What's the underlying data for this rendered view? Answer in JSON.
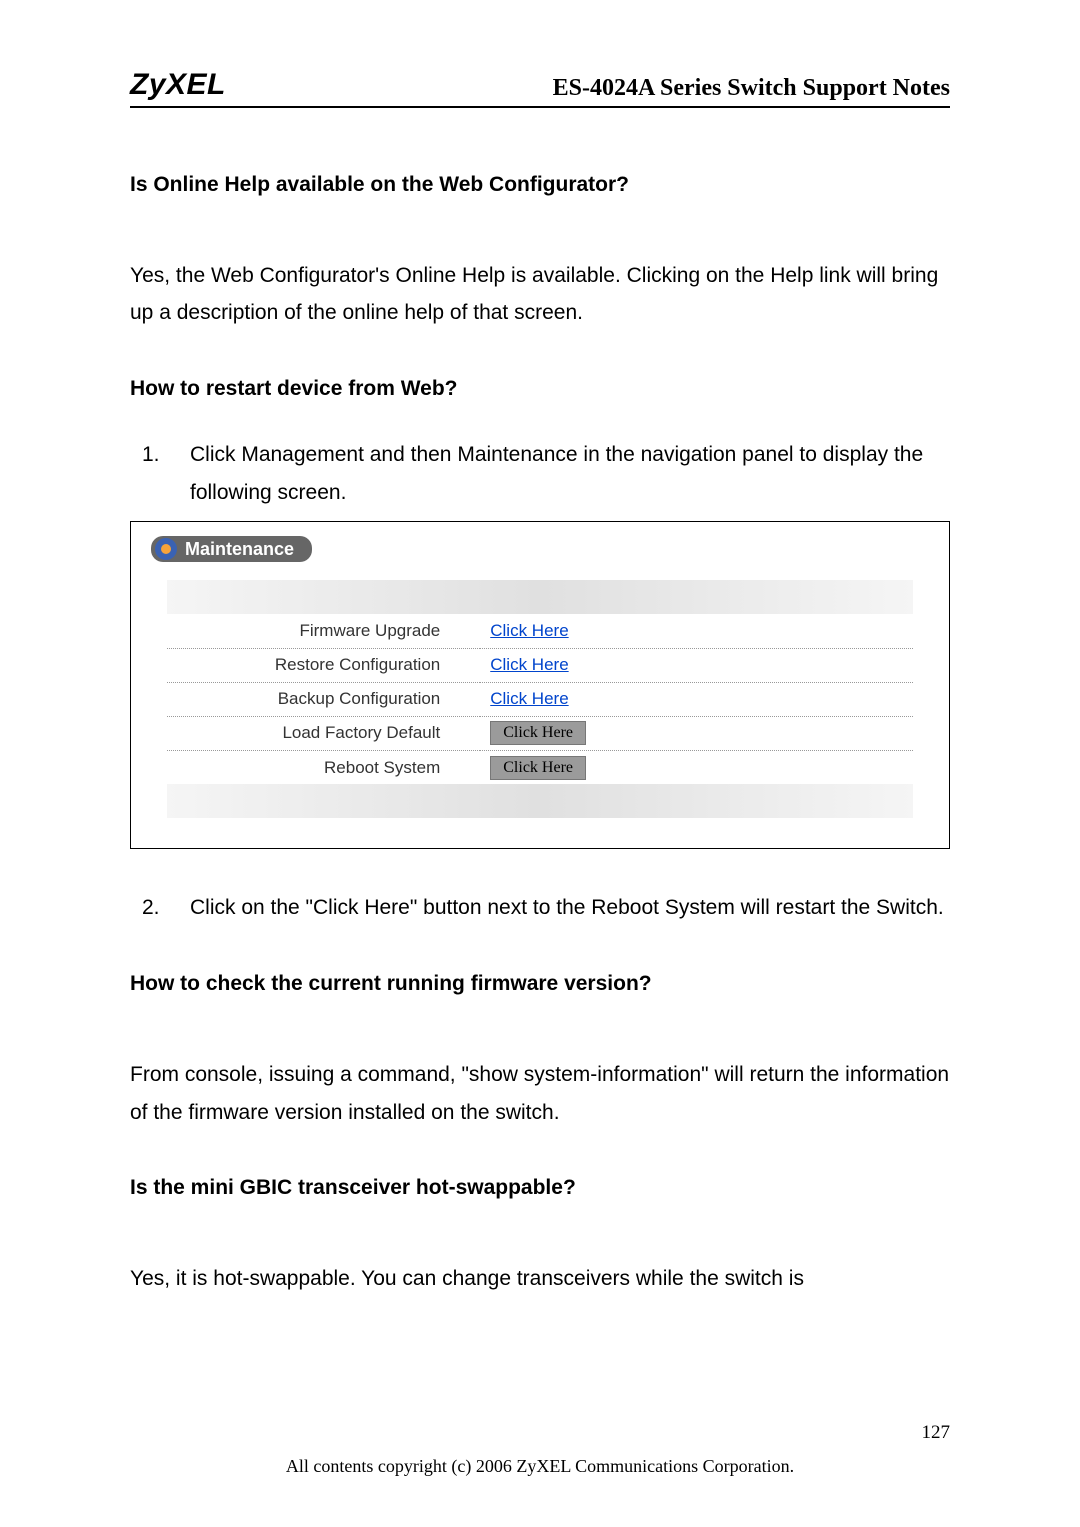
{
  "header": {
    "logo": "ZyXEL",
    "title": "ES-4024A Series Switch Support Notes"
  },
  "sections": {
    "q1": {
      "question": "Is Online Help available on the Web Configurator?",
      "answer": "Yes, the Web Configurator's Online Help is available. Clicking on the Help link will bring up a description of the online help of that screen."
    },
    "q2": {
      "question": "How to restart device from Web?",
      "step1_num": "1.",
      "step1_text": "Click Management and then Maintenance in the navigation panel to display the following screen.",
      "step2_num": "2.",
      "step2_text": "Click on the \"Click Here\" button next to the Reboot System will restart the Switch."
    },
    "maintenance": {
      "title": "Maintenance",
      "rows": [
        {
          "label": "Firmware Upgrade",
          "action_type": "link",
          "action_text": "Click Here"
        },
        {
          "label": "Restore Configuration",
          "action_type": "link",
          "action_text": "Click Here"
        },
        {
          "label": "Backup Configuration",
          "action_type": "link",
          "action_text": "Click Here"
        },
        {
          "label": "Load Factory Default",
          "action_type": "button",
          "action_text": "Click Here"
        },
        {
          "label": "Reboot System",
          "action_type": "button",
          "action_text": "Click Here"
        }
      ]
    },
    "q3": {
      "question": "How to check the current running firmware version?",
      "answer": "From console, issuing a command, \"show system-information\" will return the information of the firmware version installed on the switch."
    },
    "q4": {
      "question": "Is the mini GBIC transceiver hot-swappable?",
      "answer": "Yes, it is hot-swappable. You can change transceivers while the switch is"
    }
  },
  "footer": {
    "page": "127",
    "copyright": "All contents copyright (c) 2006 ZyXEL Communications Corporation."
  }
}
